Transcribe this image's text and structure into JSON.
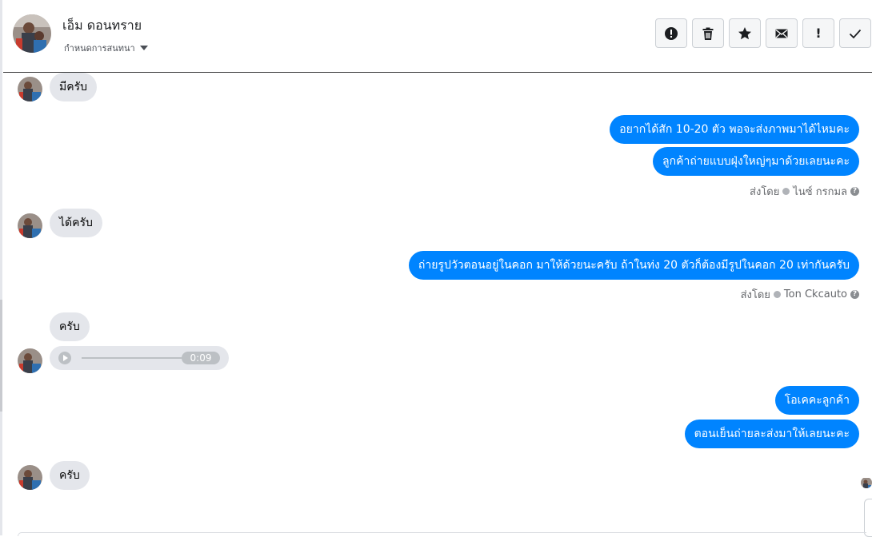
{
  "header": {
    "contact_name": "เอ็ม ดอนทราย",
    "assign_label": "กำหนดการสนทนา",
    "actions": [
      {
        "name": "mark-spam-button",
        "icon": "alert-circle-icon"
      },
      {
        "name": "delete-button",
        "icon": "trash-icon"
      },
      {
        "name": "star-button",
        "icon": "star-icon"
      },
      {
        "name": "mark-unread-button",
        "icon": "envelope-icon"
      },
      {
        "name": "important-button",
        "icon": "exclamation-icon",
        "glyph": "!"
      },
      {
        "name": "mark-done-button",
        "icon": "check-icon"
      }
    ]
  },
  "messages": {
    "m1": "มีครับ",
    "m2": "อยากได้สัก 10-20 ตัว พอจะส่งภาพมาได้ไหมคะ",
    "m3": "ลูกค้าถ่ายแบบฝุ่งใหญ่ๆมาด้วยเลยนะคะ",
    "m4": "ได้ครับ",
    "m5": "ถ่ายรูปวัวตอนอยู่ในคอก มาให้ด้วยนะครับ ถ้าในท่ง 20 ตัวก็ต้องมีรูปในคอก 20 เท่ากันครับ",
    "m6": "ครับ",
    "m7": "โอเคคะลูกค้า",
    "m8": "ตอนเย็นถ่ายละส่งมาให้เลยนะคะ",
    "m9": "ครับ"
  },
  "sent_by": {
    "prefix": "ส่งโดย",
    "agent1": "ไนซ์ กรกมล",
    "agent2": "Ton Ckcauto",
    "help_glyph": "?"
  },
  "audio": {
    "duration": "0:09"
  },
  "colors": {
    "outgoing": "#0084ff",
    "incoming": "#e4e6eb"
  }
}
